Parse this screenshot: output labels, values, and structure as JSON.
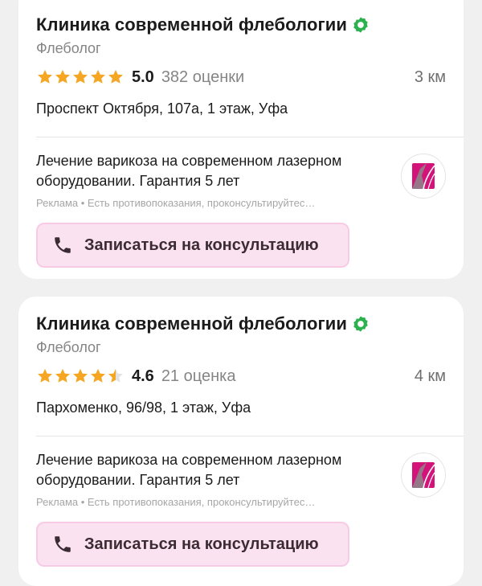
{
  "cards": [
    {
      "title": "Клиника современной флебологии",
      "specialty": "Флеболог",
      "rating": "5.0",
      "rating_fraction": 1.0,
      "reviews": "382 оценки",
      "distance": "3 км",
      "address": "Проспект Октября, 107а, 1 этаж, Уфа",
      "ad_text": "Лечение варикоза на современном лазерном оборудовании. Гарантия 5 лет",
      "ad_disclaimer": "Реклама • Есть противопоказания, проконсультируйтес…",
      "cta_label": "Записаться на консультацию"
    },
    {
      "title": "Клиника современной флебологии",
      "specialty": "Флеболог",
      "rating": "4.6",
      "rating_fraction": 0.92,
      "reviews": "21 оценка",
      "distance": "4 км",
      "address": "Пархоменко, 96/98, 1 этаж, Уфа",
      "ad_text": "Лечение варикоза на современном лазерном оборудовании. Гарантия 5 лет",
      "ad_disclaimer": "Реклама • Есть противопоказания, проконсультируйтес…",
      "cta_label": "Записаться на консультацию"
    }
  ],
  "colors": {
    "star": "#f5a623",
    "verified": "#2bb24c",
    "cta_bg": "#fbe2f1",
    "logo_brand": "#d4137a"
  },
  "icons": {
    "verified": "verified-badge-icon",
    "star": "star-icon",
    "phone": "phone-icon",
    "logo": "clinic-logo-icon"
  }
}
